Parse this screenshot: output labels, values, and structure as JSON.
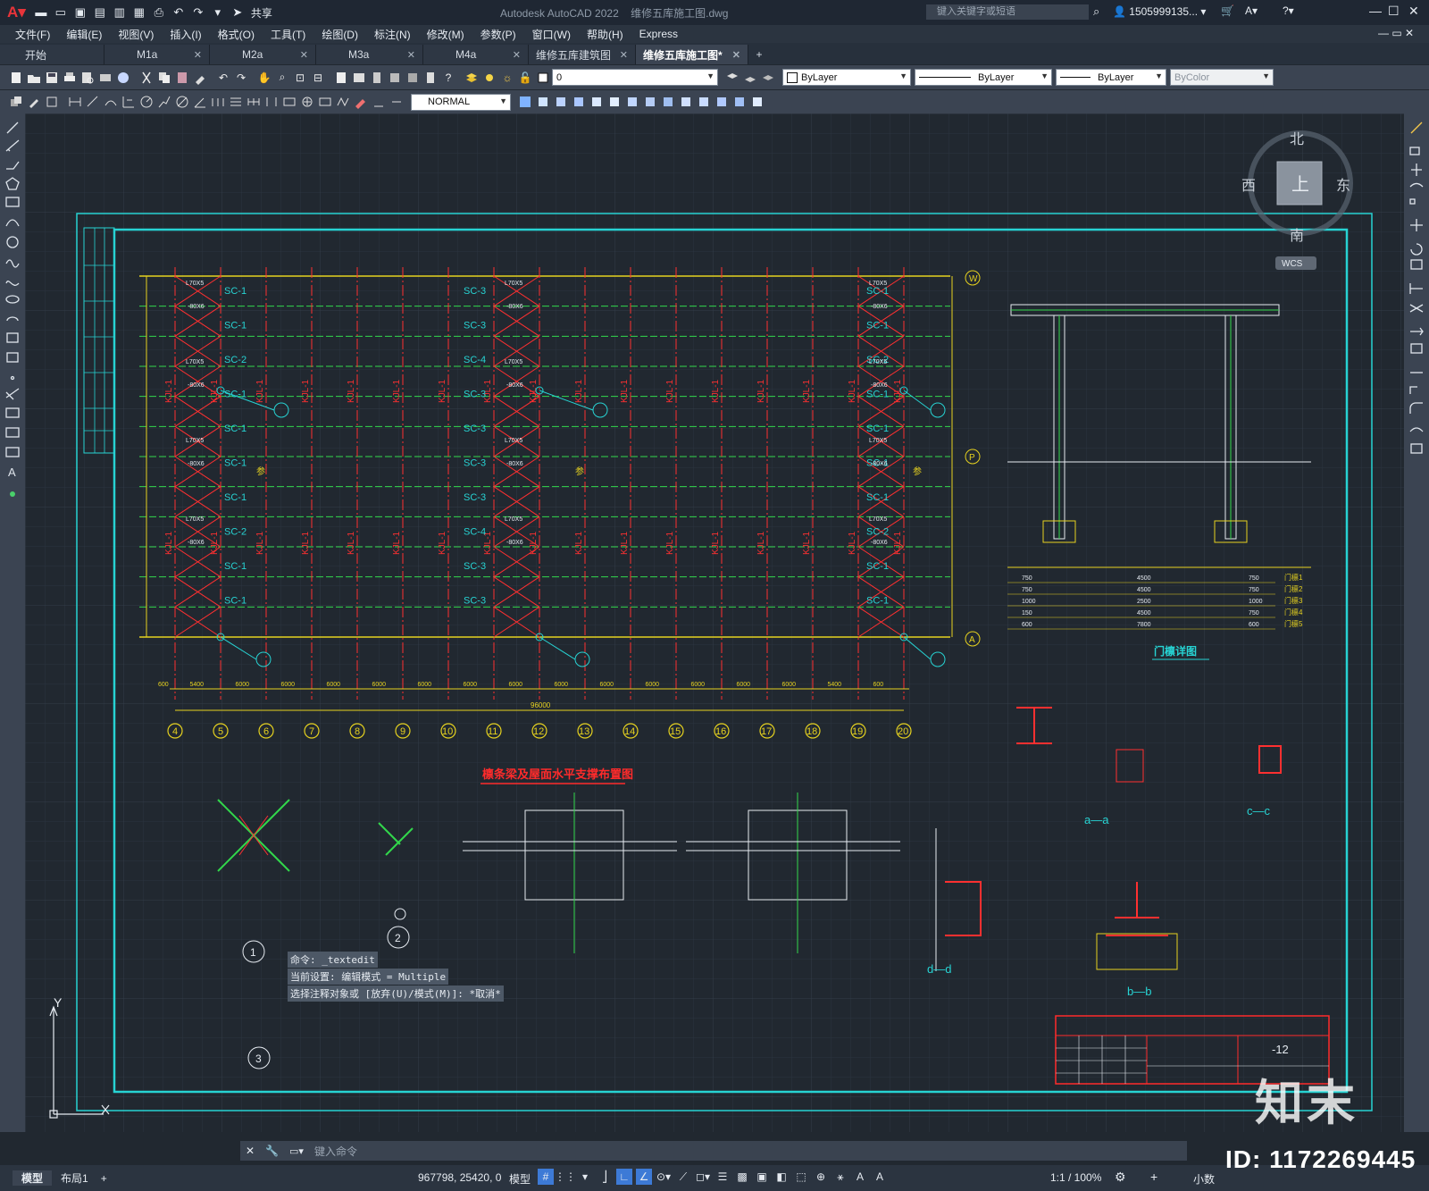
{
  "app": {
    "quick_access_share": "共享",
    "title": "Autodesk AutoCAD 2022",
    "filename": "维修五库施工图.dwg",
    "search_placeholder": "键入关键字或短语",
    "user": "1505999135..."
  },
  "menu": [
    "文件(F)",
    "编辑(E)",
    "视图(V)",
    "插入(I)",
    "格式(O)",
    "工具(T)",
    "绘图(D)",
    "标注(N)",
    "修改(M)",
    "参数(P)",
    "窗口(W)",
    "帮助(H)",
    "Express"
  ],
  "tabs": [
    {
      "label": "开始",
      "closable": false,
      "active": false
    },
    {
      "label": "M1a",
      "closable": true,
      "active": false
    },
    {
      "label": "M2a",
      "closable": true,
      "active": false
    },
    {
      "label": "M3a",
      "closable": true,
      "active": false
    },
    {
      "label": "M4a",
      "closable": true,
      "active": false
    },
    {
      "label": "维修五库建筑图",
      "closable": true,
      "active": false
    },
    {
      "label": "维修五库施工图*",
      "closable": true,
      "active": true
    }
  ],
  "properties": {
    "layer": "0",
    "color": "ByLayer",
    "linetype": "ByLayer",
    "lineweight": "ByLayer",
    "plotstyle": "ByColor",
    "dimstyle": "NORMAL"
  },
  "viewcube": {
    "north": "北",
    "south": "南",
    "east": "东",
    "west": "西",
    "top": "上",
    "wcs": "WCS"
  },
  "ucs": {
    "y": "Y"
  },
  "drawing": {
    "plan_title": "檩条梁及屋面水平支撑布置图",
    "portal_title": "门檩详图",
    "column_labels": [
      "4",
      "5",
      "6",
      "7",
      "8",
      "9",
      "10",
      "11",
      "12",
      "13",
      "14",
      "15",
      "16",
      "17",
      "18",
      "19",
      "20"
    ],
    "row_labels": [
      "W",
      "P",
      "A"
    ],
    "span_dims": [
      "600",
      "5400",
      "6000",
      "6000",
      "6000",
      "6000",
      "6000",
      "6000",
      "6000",
      "6000",
      "6000",
      "6000",
      "6000",
      "6000",
      "6000",
      "5400",
      "600"
    ],
    "total_dim": "96000",
    "beam_label": "KJL-1",
    "brace_left": [
      "SC-1",
      "SC-1",
      "SC-2",
      "SC-1",
      "SC-1",
      "SC-1",
      "SC-1",
      "SC-2",
      "SC-1",
      "SC-1"
    ],
    "brace_mid": [
      "SC-3",
      "SC-3",
      "SC-4",
      "SC-3",
      "SC-3",
      "SC-3",
      "SC-3",
      "SC-4",
      "SC-3",
      "SC-3"
    ],
    "brace_right": [
      "SC-1",
      "SC-1",
      "SC-2",
      "SC-1",
      "SC-1",
      "SC-1",
      "SC-1",
      "SC-2",
      "SC-1",
      "SC-1"
    ],
    "angle_label": "L70X5",
    "plate_label": "-80X6",
    "ref_label": "参",
    "section_labels": [
      "a—a",
      "c—c",
      "d—d",
      "b—b"
    ],
    "detail_numbers": [
      "1",
      "2",
      "3"
    ],
    "title_block_no": "-12",
    "portal_rows": [
      {
        "l": "750",
        "m": "4500",
        "r": "750",
        "name": "门檩1"
      },
      {
        "l": "750",
        "m": "4500",
        "r": "750",
        "name": "门檩2"
      },
      {
        "l": "1000",
        "m": "2500",
        "r": "1000",
        "name": "门檩3"
      },
      {
        "l": "150",
        "m": "4500",
        "r": "750",
        "name": "门檩4"
      },
      {
        "l": "600",
        "m": "7800",
        "r": "600",
        "name": "门檩5"
      }
    ]
  },
  "command": {
    "history": [
      "命令: _textedit",
      "当前设置: 编辑模式 = Multiple",
      "选择注释对象或 [放弃(U)/模式(M)]: *取消*"
    ],
    "placeholder": "键入命令"
  },
  "status": {
    "tabs": [
      "模型",
      "布局1"
    ],
    "coords": "967798, 25420, 0",
    "space": "模型",
    "scale": "1:1 / 100%",
    "units": "小数"
  },
  "watermark": {
    "id": "ID: 1172269445",
    "logo": "知末"
  }
}
